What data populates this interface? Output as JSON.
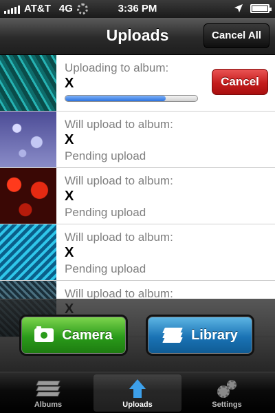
{
  "status_bar": {
    "carrier": "AT&T",
    "network": "4G",
    "time": "3:36 PM"
  },
  "nav": {
    "title": "Uploads",
    "cancel_all_label": "Cancel All"
  },
  "uploads": [
    {
      "label": "Uploading to album:",
      "album": "X",
      "status": "",
      "progress": 0.76,
      "cancel_label": "Cancel"
    },
    {
      "label": "Will upload to album:",
      "album": "X",
      "status": "Pending upload"
    },
    {
      "label": "Will upload to album:",
      "album": "X",
      "status": "Pending upload"
    },
    {
      "label": "Will upload to album:",
      "album": "X",
      "status": "Pending upload"
    },
    {
      "label": "Will upload to album:",
      "album": "X",
      "status": ""
    }
  ],
  "actions": {
    "camera_label": "Camera",
    "library_label": "Library",
    "camera_color": "#2a9b1a",
    "library_color": "#1a73b5"
  },
  "tabs": [
    {
      "label": "Albums",
      "icon": "albums-icon"
    },
    {
      "label": "Uploads",
      "icon": "upload-arrow-icon",
      "active": true
    },
    {
      "label": "Settings",
      "icon": "gear-icon"
    }
  ]
}
